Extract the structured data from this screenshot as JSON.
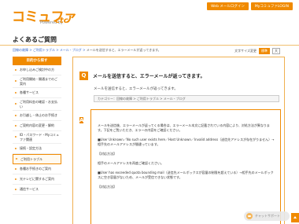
{
  "header": {
    "logo_text": "コミュファ",
    "logo_sub": "Powered by",
    "logo_brand": "ctc",
    "buttons": [
      "Web メールログイン",
      "MyコミュファLOGIN"
    ]
  },
  "page_title": "よくあるご質問",
  "breadcrumb": {
    "items": [
      "回線の故障",
      "ご利用トラブル",
      "メール・ブログ",
      "メールを送信すると、エラーメールが返ってきます。"
    ],
    "separator": " > "
  },
  "tools": {
    "label": "文字サイズ変更",
    "sizes": [
      "標準",
      "大"
    ],
    "active": "標準"
  },
  "sidebar": {
    "heading": "目的から探す",
    "items": [
      "お申し込みご検討中の方",
      "ご利用開始・開通までのご案内",
      "各種サービス",
      "ご利用料金の確認・お支払い",
      "お引越し・休止のお手続き",
      "ご契約内容の変更・解約",
      "ID・パスワード・Myコミュファ関連",
      "接続・設定方法",
      "ご利用トラブル",
      "各種お手続きのご案内",
      "光テレビに関するご案内",
      "通信サービス"
    ],
    "selected_index": 8
  },
  "question": {
    "badge": "Q",
    "title": "メールを送信すると、エラーメールが返ってきます。",
    "body": "メールを送信すると、エラーメールが返ってきます。",
    "category": "カテゴリー：回線の故障 > ご利用トラブル > メール・ブログ"
  },
  "answer": {
    "badge": "A",
    "lines": [
      "メールを送信後、エラーメールが返ってくる場合は、エラーメール本文に記載されている内容により、対処方法が異なります。下記をご覧いただき、エラーの内容をご確認ください。",
      "■User Unknown／No such user exists here／Host Unknown／Invalid address（送信先アドレスが存在がりません）→相手先のメールアドレスが間違っています。",
      "【対応方法】",
      "相手のメールアドレスを再度ご確認ください。",
      "■User has exceeded quota bounding mail（送信先メールボックスが容量の制限を超えている）→相手先のメールボックスに空き容量がないため、メールが受信できない状態です。",
      "【対応方法】"
    ]
  },
  "chat": {
    "label": "チャットサポート"
  }
}
